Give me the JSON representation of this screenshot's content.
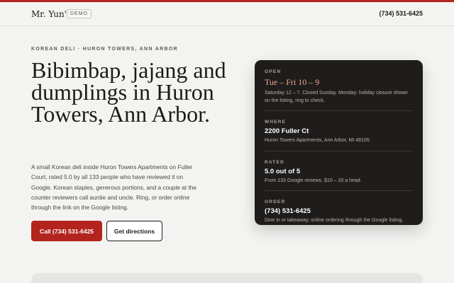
{
  "header": {
    "brand": "Mr. Yun's",
    "badge": "DEMO",
    "phone": "(734) 531-6425"
  },
  "hero": {
    "eyebrow": "KOREAN DELI · HURON TOWERS, ANN ARBOR",
    "title": "Bibimbap, jajang and dumplings in Huron Towers, Ann Arbor.",
    "description": "A small Korean deli inside Huron Towers Apartments on Fuller Court, rated 5.0 by all 133 people who have reviewed it on Google. Korean staples, generous portions, and a couple at the counter reviewers call auntie and uncle. Ring, or order online through the link on the Google listing.",
    "call_button": "Call (734) 531-6425",
    "directions_button": "Get directions"
  },
  "info": {
    "open": {
      "label": "OPEN",
      "value": "Tue – Fri 10 – 9",
      "note": "Saturday 12 – 7. Closed Sunday. Monday: holiday closure shown on the listing, ring to check."
    },
    "where": {
      "label": "WHERE",
      "value": "2200 Fuller Ct",
      "note": "Huron Towers Apartments, Ann Arbor, MI 48105"
    },
    "rated": {
      "label": "RATED",
      "value": "5.0 out of 5",
      "note": "From 133 Google reviews. $10 – 20 a head."
    },
    "order": {
      "label": "ORDER",
      "value": "(734) 531-6425",
      "note": "Dine in or takeaway; online ordering through the Google listing."
    }
  },
  "colors": {
    "accent": "#b3241e",
    "card_bg": "#1f1d1c",
    "hours_highlight": "#f2a58e",
    "page_bg": "#f3f3f1"
  }
}
